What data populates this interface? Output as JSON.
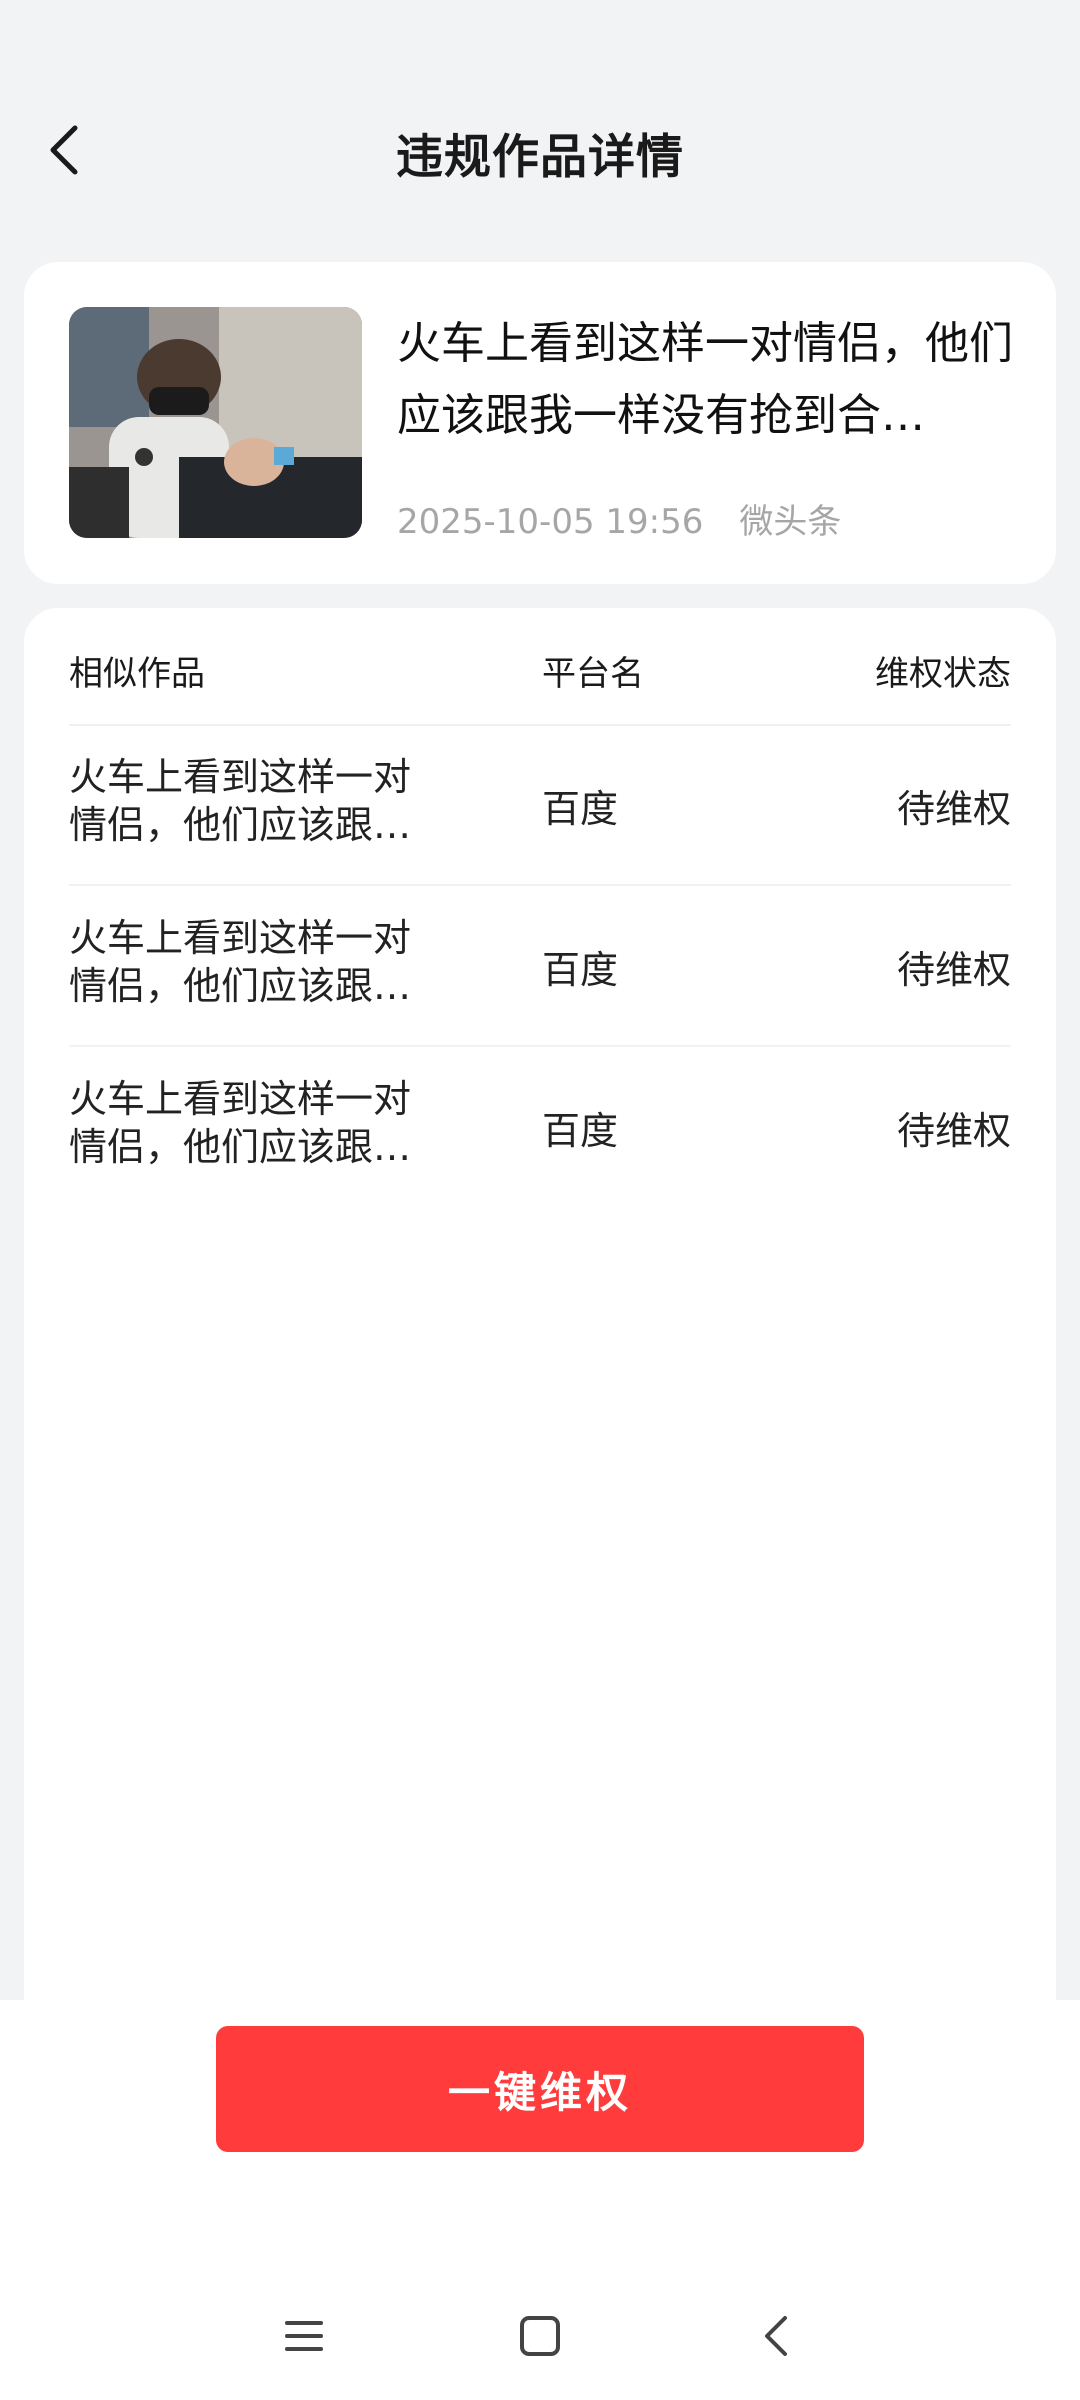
{
  "header": {
    "title": "违规作品详情"
  },
  "work": {
    "title": "火车上看到这样一对情侣，他们应该跟我一样没有抢到合…",
    "datetime": "2025-10-05 19:56",
    "source": "微头条"
  },
  "table": {
    "headers": [
      "相似作品",
      "平台名",
      "维权状态"
    ],
    "rows": [
      {
        "name": "火车上看到这样一对情侣，他们应该跟…",
        "platform": "百度",
        "status": "待维权"
      },
      {
        "name": "火车上看到这样一对情侣，他们应该跟…",
        "platform": "百度",
        "status": "待维权"
      },
      {
        "name": "火车上看到这样一对情侣，他们应该跟…",
        "platform": "百度",
        "status": "待维权"
      }
    ]
  },
  "action": {
    "label": "一键维权"
  },
  "colors": {
    "accent": "#ff3b3b",
    "background": "#f2f3f5"
  }
}
